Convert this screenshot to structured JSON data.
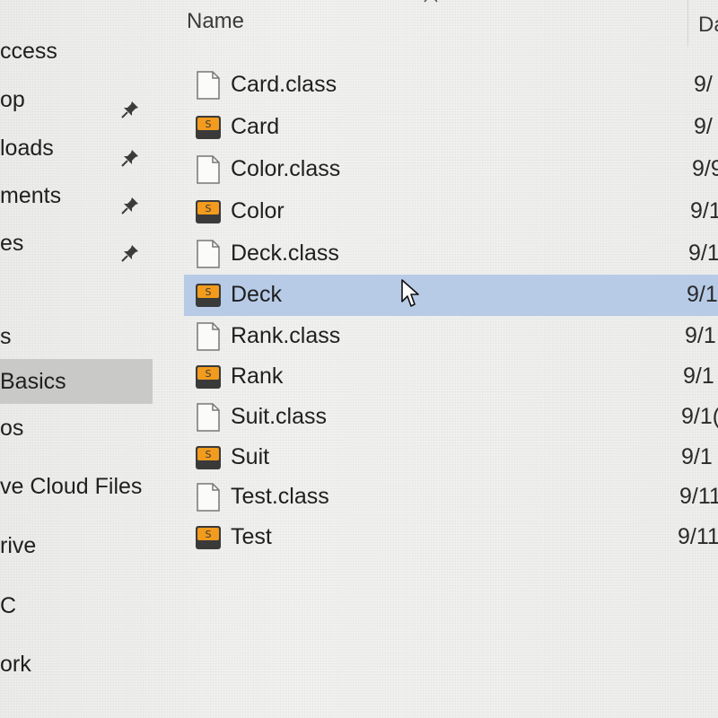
{
  "nav": {
    "items": [
      {
        "label": "ccess",
        "pinned": false
      },
      {
        "label": "op",
        "pinned": true
      },
      {
        "label": "loads",
        "pinned": true
      },
      {
        "label": "ments",
        "pinned": true
      },
      {
        "label": "es",
        "pinned": true
      },
      {
        "label": "s",
        "pinned": false
      },
      {
        "label": "Basics",
        "pinned": false,
        "selected": true
      },
      {
        "label": "os",
        "pinned": false
      },
      {
        "label": "ve Cloud Files",
        "pinned": false
      },
      {
        "label": "rive",
        "pinned": false
      },
      {
        "label": "C",
        "pinned": false
      },
      {
        "label": "ork",
        "pinned": false
      }
    ]
  },
  "header": {
    "name_label": "Name",
    "date_label": "Da"
  },
  "files": [
    {
      "name": "Card.class",
      "type": "class-file",
      "date": "9/"
    },
    {
      "name": "Card",
      "type": "sublime-file",
      "date": "9/"
    },
    {
      "name": "Color.class",
      "type": "class-file",
      "date": "9/9"
    },
    {
      "name": "Color",
      "type": "sublime-file",
      "date": "9/1"
    },
    {
      "name": "Deck.class",
      "type": "class-file",
      "date": "9/1"
    },
    {
      "name": "Deck",
      "type": "sublime-file",
      "date": "9/1",
      "selected": true
    },
    {
      "name": "Rank.class",
      "type": "class-file",
      "date": "9/1"
    },
    {
      "name": "Rank",
      "type": "sublime-file",
      "date": "9/1"
    },
    {
      "name": "Suit.class",
      "type": "class-file",
      "date": "9/1("
    },
    {
      "name": "Suit",
      "type": "sublime-file",
      "date": "9/1"
    },
    {
      "name": "Test.class",
      "type": "class-file",
      "date": "9/11"
    },
    {
      "name": "Test",
      "type": "sublime-file",
      "date": "9/11"
    }
  ],
  "colors": {
    "selection": "#b7cbe7",
    "nav_selection": "#c9c9c7",
    "sublime_icon_bg": "#3a3a3a",
    "sublime_icon_accent": "#f29b1d"
  }
}
